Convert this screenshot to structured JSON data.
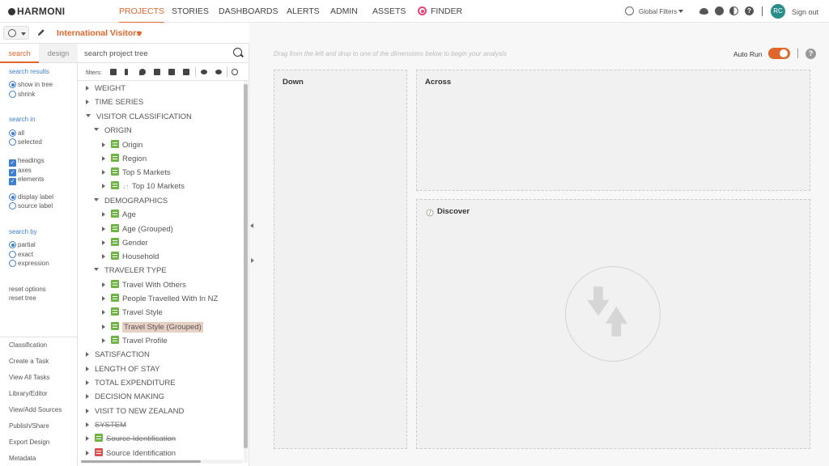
{
  "app": {
    "brand": "HARMONI",
    "nav": [
      {
        "label": "PROJECTS",
        "active": true
      },
      {
        "label": "STORIES",
        "active": false
      },
      {
        "label": "DASHBOARDS",
        "active": false
      },
      {
        "label": "ALERTS",
        "active": false
      },
      {
        "label": "ADMIN",
        "active": false
      },
      {
        "label": "ASSETS",
        "active": false
      },
      {
        "label": "FINDER",
        "active": false
      }
    ],
    "global_filters": "Global Filters",
    "user_initials": "RC",
    "sign_out": "Sign out"
  },
  "project": {
    "title": "International Visitors"
  },
  "options": {
    "tabs": {
      "search": "search",
      "design": "design"
    },
    "search_results": {
      "title": "search results",
      "show_in_tree": "show in tree",
      "shrink": "shrink"
    },
    "search_in": {
      "title": "search in",
      "all": "all",
      "selected": "selected",
      "headings": "headings",
      "axes": "axes",
      "elements": "elements",
      "display_label": "display label",
      "source_label": "source label"
    },
    "search_by": {
      "title": "search by",
      "partial": "partial",
      "exact": "exact",
      "expression": "expression"
    },
    "reset_options": "reset options",
    "reset_tree": "reset tree",
    "menu": [
      "Classification",
      "Create a Task",
      "View All Tasks",
      "Library/Editor",
      "View/Add Sources",
      "Publish/Share",
      "Export Design",
      "Metadata"
    ]
  },
  "tree_panel": {
    "search_placeholder": "search project tree",
    "filters_label": "filters:"
  },
  "tree": {
    "weight": "WEIGHT",
    "time_series": "TIME SERIES",
    "visitor_classification": "VISITOR CLASSIFICATION",
    "origin_group": "ORIGIN",
    "origin": "Origin",
    "region": "Region",
    "top5": "Top 5 Markets",
    "top10": "Top 10 Markets",
    "demographics": "DEMOGRAPHICS",
    "age": "Age",
    "age_grouped": "Age (Grouped)",
    "gender": "Gender",
    "household": "Household",
    "traveler_type": "TRAVELER TYPE",
    "travel_with_others": "Travel With Others",
    "people_travelled": "People Travelled With In NZ",
    "travel_style": "Travel Style",
    "travel_style_grouped": "Travel Style (Grouped)",
    "travel_profile": "Travel Profile",
    "satisfaction": "SATISFACTION",
    "length_of_stay": "LENGTH OF STAY",
    "total_expenditure": "TOTAL EXPENDITURE",
    "decision_making": "DECISION MAKING",
    "visit_nz": "VISIT TO NEW ZEALAND",
    "system": "SYSTEM",
    "source_id_struck": "Source Identification",
    "source_id": "Source Identification"
  },
  "main": {
    "hint": "Drag from the left and drop to one of the dimensions below to begin your analysis",
    "auto_run": "Auto Run",
    "auto_run_on": true,
    "down": "Down",
    "across": "Across",
    "discover": "Discover"
  },
  "colors": {
    "accent": "#e0662b",
    "link": "#3d7fd0",
    "element_icon": "#6fb544",
    "avatar": "#2a8f8a"
  }
}
